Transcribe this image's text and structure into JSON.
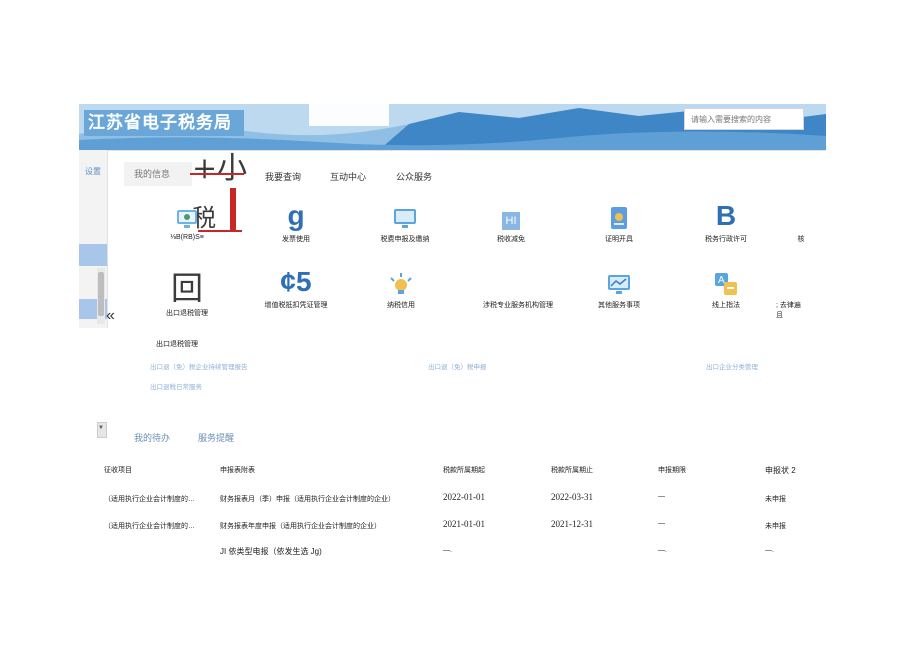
{
  "header": {
    "title": "江苏省电子税务局",
    "search_placeholder": "请输入需要搜索的内容"
  },
  "left": {
    "settings_label": "设置",
    "collapse_glyph": "«"
  },
  "nav": {
    "tabs": [
      "我的信息",
      "我要查询",
      "互动中心",
      "公众服务"
    ]
  },
  "overlay": {
    "glyph_top": "+小",
    "glyph_mid": "税"
  },
  "services_row1": [
    {
      "label": "⅛B(RB)S≡",
      "icon": "monitor-gear-icon"
    },
    {
      "label": "发票使用",
      "icon_text": "g"
    },
    {
      "label": "税费申报及缴纳",
      "icon": "monitor-icon"
    },
    {
      "label": "税收减免",
      "icon_text": "HI"
    },
    {
      "label": "证明开具",
      "icon": "certificate-icon"
    },
    {
      "label": "税务行政许可",
      "icon_text": "B"
    },
    {
      "label": "核",
      "icon": "none"
    }
  ],
  "services_row2": [
    {
      "label": "出口退税管理",
      "icon_text": "回"
    },
    {
      "label": "增值税抵扣凭证管理",
      "icon_text": "¢5"
    },
    {
      "label": "纳税信用",
      "icon": "lightbulb-icon"
    },
    {
      "label": "涉税专业服务机构管理",
      "icon": "none"
    },
    {
      "label": "其他服务事项",
      "icon": "chart-monitor-icon"
    },
    {
      "label": "线上指法",
      "icon": "translate-icon"
    },
    {
      "label": "; 去律遍\n且",
      "icon": "none"
    }
  ],
  "export_section": {
    "heading": "出口退税管理",
    "links_row1": [
      "出口退（免）税企业持续管理报告",
      "出口退（免）税申报",
      "出口企业分类管理"
    ],
    "links_row2": [
      "出口退税日常服务"
    ]
  },
  "todo": {
    "tabs": [
      "我的待办",
      "服务提醒"
    ],
    "columns": [
      "征收项目",
      "申报表附表",
      "税款所属期起",
      "税款所属期止",
      "申报期限",
      "申报状 2"
    ],
    "rows": [
      [
        "（适用执行企业会计制度的…",
        "财务报表月（季）申报（适用执行企业会计制度的企业）",
        "2022-01-01",
        "2022-03-31",
        "—",
        "未申报"
      ],
      [
        "（适用执行企业会计制度的…",
        "财务报表年度申报（适用执行企业会计制度的企业）",
        "2021-01-01",
        "2021-12-31",
        "—",
        "未申报"
      ],
      [
        "",
        "JI 依类型电报（依发生选 Jg)",
        "—.",
        "",
        "—.",
        "—."
      ]
    ]
  }
}
